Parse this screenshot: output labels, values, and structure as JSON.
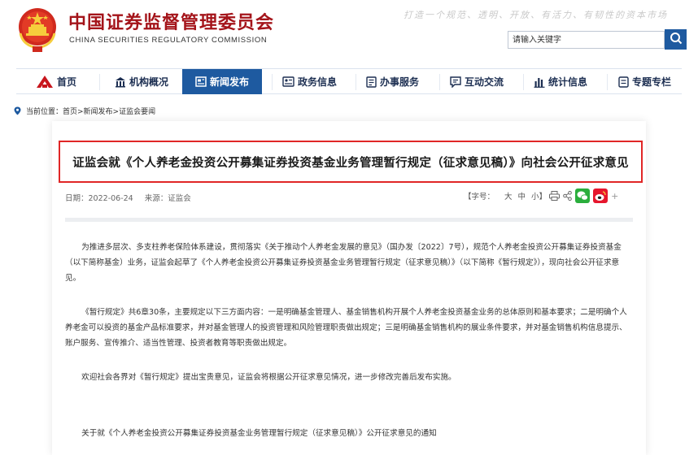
{
  "header": {
    "org_name_cn": "中国证券监督管理委员会",
    "org_name_en": "CHINA SECURITIES REGULATORY COMMISSION",
    "slogan": "打造一个规范、透明、开放、有活力、有韧性的资本市场",
    "search_placeholder": "请输入关键字",
    "emblem_icon": "national-emblem-icon",
    "search_icon": "search-icon"
  },
  "nav": {
    "items": [
      {
        "label": "首页",
        "icon": "home-logo-icon",
        "active": false
      },
      {
        "label": "机构概况",
        "icon": "institution-icon",
        "active": false
      },
      {
        "label": "新闻发布",
        "icon": "news-icon",
        "active": true
      },
      {
        "label": "政务信息",
        "icon": "government-info-icon",
        "active": false
      },
      {
        "label": "办事服务",
        "icon": "service-icon",
        "active": false
      },
      {
        "label": "互动交流",
        "icon": "chat-icon",
        "active": false
      },
      {
        "label": "统计信息",
        "icon": "statistics-icon",
        "active": false
      },
      {
        "label": "专题专栏",
        "icon": "topic-icon",
        "active": false
      }
    ]
  },
  "breadcrumb": {
    "prefix": "当前位置：",
    "path": "首页>新闻发布>证监会要闻"
  },
  "article": {
    "title": "证监会就《个人养老金投资公开募集证券投资基金业务管理暂行规定（征求意见稿）》向社会公开征求意见",
    "date_label": "日期：",
    "date": "2022-06-24",
    "source_label": "来源：",
    "source": "证监会",
    "font_size_label": "【字号：",
    "font_sizes": [
      "大",
      "中",
      "小"
    ],
    "font_size_close": "】",
    "share_plus": "+",
    "paragraphs": [
      "为推进多层次、多支柱养老保险体系建设，贯彻落实《关于推动个人养老金发展的意见》（国办发〔2022〕7号），规范个人养老金投资公开募集证券投资基金（以下简称基金）业务，证监会起草了《个人养老金投资公开募集证券投资基金业务管理暂行规定（征求意见稿）》（以下简称《暂行规定》），现向社会公开征求意见。",
      "《暂行规定》共6章30条，主要规定以下三方面内容：一是明确基金管理人、基金销售机构开展个人养老金投资基金业务的总体原则和基本要求；二是明确个人养老金可以投资的基金产品标准要求，并对基金管理人的投资管理和风险管理职责做出规定；三是明确基金销售机构的展业条件要求，并对基金销售机构信息提示、账户服务、宣传推介、适当性管理、投资者教育等职责做出规定。",
      "欢迎社会各界对《暂行规定》提出宝贵意见，证监会将根据公开征求意见情况，进一步修改完善后发布实施。",
      "关于就《个人养老金投资公开募集证券投资基金业务管理暂行规定（征求意见稿）》公开征求意见的通知"
    ]
  },
  "colors": {
    "brand_red": "#a4141a",
    "nav_blue": "#1e5aa0",
    "highlight_red": "#e02626",
    "wechat_green": "#2aae3c",
    "weibo_red": "#e6162d"
  }
}
